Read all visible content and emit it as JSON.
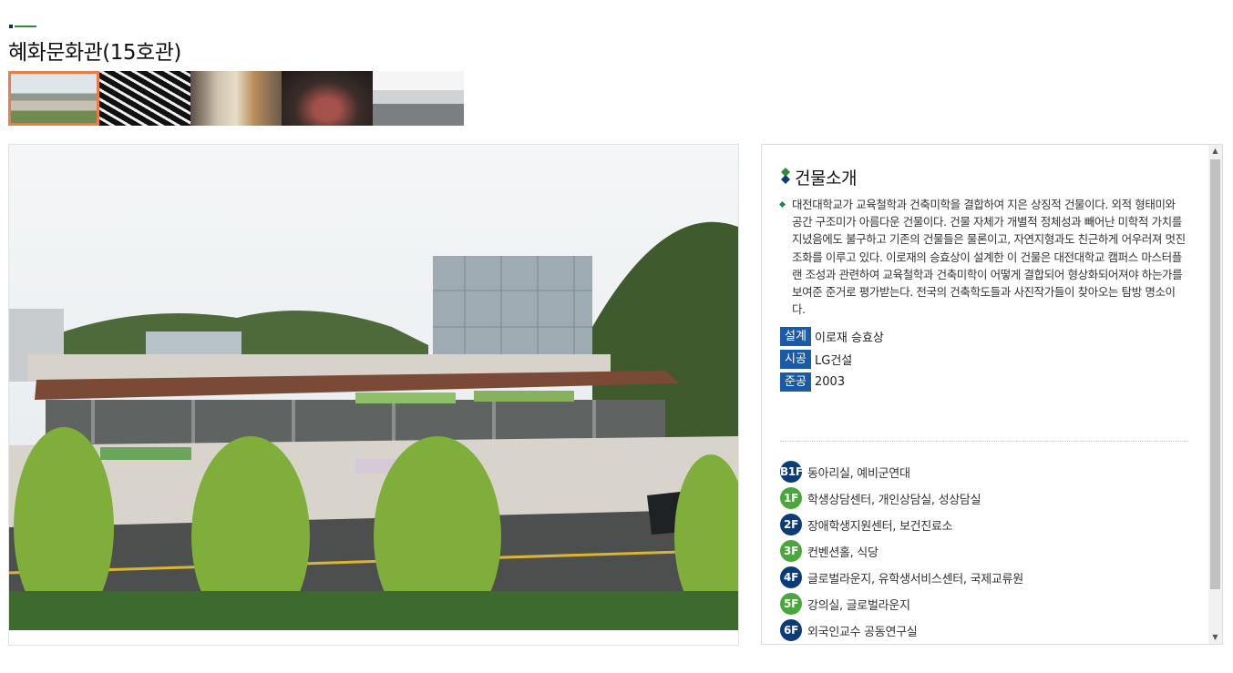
{
  "page": {
    "title": "혜화문화관(15호관)"
  },
  "gallery": {
    "thumbnails": [
      "exterior",
      "stairs",
      "interior-hall",
      "theater",
      "corridor"
    ],
    "active_index": 0
  },
  "info": {
    "section_title": "건물소개",
    "description": "대전대학교가 교육철학과 건축미학을 결합하여 지은 상징적 건물이다. 외적 형태미와 공간 구조미가 아름다운 건물이다. 건물 자체가 개별적 정체성과 빼어난 미학적 가치를 지녔음에도 불구하고 기존의 건물들은 물론이고, 자연지형과도 친근하게 어우러져 멋진 조화를 이루고 있다. 이로재의 승효상이 설계한 이 건물은 대전대학교 캠퍼스 마스터플랜 조성과 관련하여 교육철학과 건축미학이 어떻게 결합되어 형상화되어져야 하는가를 보여준 준거로 평가받는다. 전국의 건축학도들과 사진작가들이 찾아오는 탐방 명소이다.",
    "specs": [
      {
        "label": "설계",
        "value": "이로재 승효상"
      },
      {
        "label": "시공",
        "value": "LG건설"
      },
      {
        "label": "준공",
        "value": "2003"
      }
    ],
    "floors": [
      {
        "badge": "B1F",
        "text": "동아리실, 예비군연대",
        "color": "#0d3b78"
      },
      {
        "badge": "1F",
        "text": "학생상담센터, 개인상담실, 성상담실",
        "color": "#49a83c"
      },
      {
        "badge": "2F",
        "text": "장애학생지원센터, 보건진료소",
        "color": "#0d3b78"
      },
      {
        "badge": "3F",
        "text": "컨벤션홀, 식당",
        "color": "#49a83c"
      },
      {
        "badge": "4F",
        "text": "글로벌라운지, 유학생서비스센터, 국제교류원",
        "color": "#0d3b78"
      },
      {
        "badge": "5F",
        "text": "강의실, 글로벌라운지",
        "color": "#49a83c"
      },
      {
        "badge": "6F",
        "text": "외국인교수 공동연구실",
        "color": "#0d3b78"
      }
    ]
  },
  "colors": {
    "accent_navy": "#0d3b78",
    "accent_green": "#49a83c",
    "spec_label": "#1b5aa6",
    "active_thumb_border": "#ee7a4a"
  }
}
